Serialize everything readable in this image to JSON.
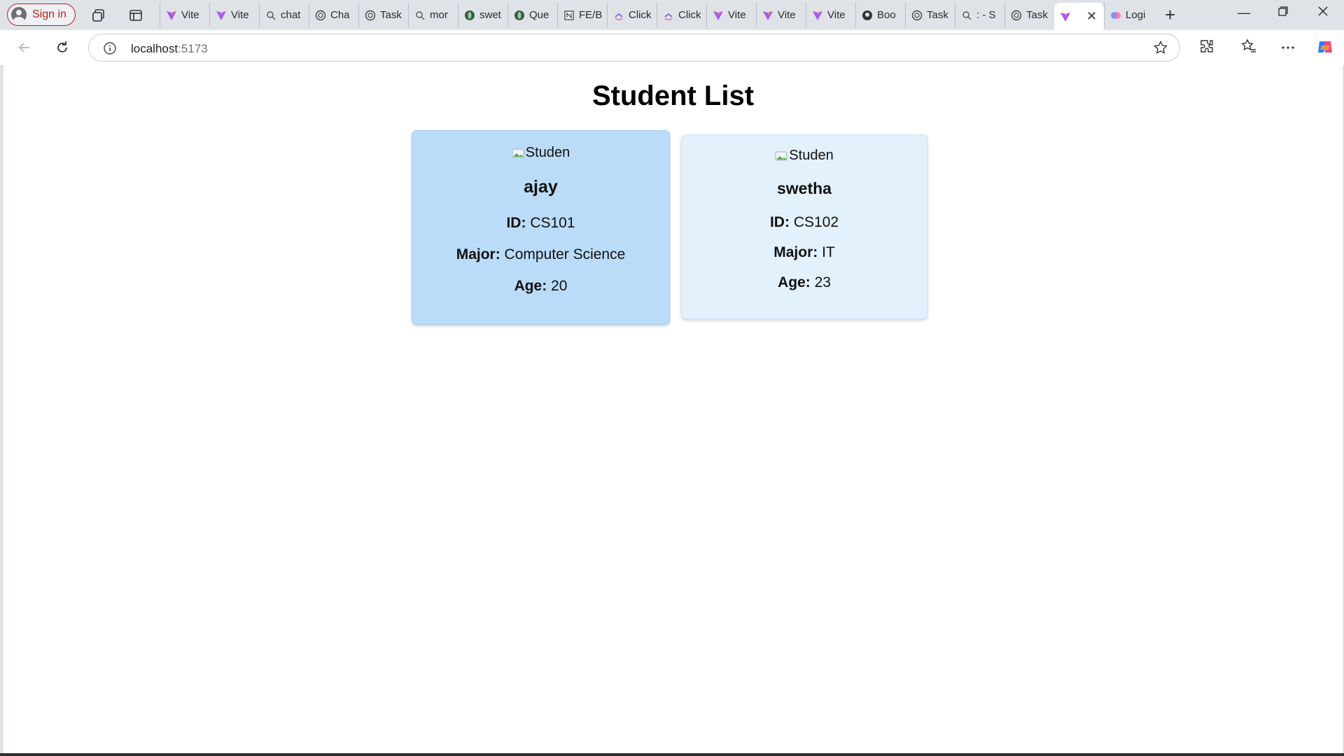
{
  "browser": {
    "signin_label": "Sign in",
    "tabs": [
      {
        "label": "Vite",
        "icon": "vite-icon"
      },
      {
        "label": "Vite",
        "icon": "vite-icon"
      },
      {
        "label": "chat",
        "icon": "search-icon"
      },
      {
        "label": "Cha",
        "icon": "chatgpt-icon"
      },
      {
        "label": "Task",
        "icon": "chatgpt-icon"
      },
      {
        "label": "mor",
        "icon": "search-icon"
      },
      {
        "label": "swet",
        "icon": "green-leaf-icon"
      },
      {
        "label": "Que",
        "icon": "green-leaf-icon"
      },
      {
        "label": "FE/B",
        "icon": "notion-icon"
      },
      {
        "label": "Click",
        "icon": "clickup-icon"
      },
      {
        "label": "Click",
        "icon": "clickup-icon"
      },
      {
        "label": "Vite",
        "icon": "vite-icon"
      },
      {
        "label": "Vite",
        "icon": "vite-icon"
      },
      {
        "label": "Vite",
        "icon": "vite-icon"
      },
      {
        "label": "Boo",
        "icon": "github-icon"
      },
      {
        "label": "Task",
        "icon": "chatgpt-icon"
      },
      {
        "label": ": - S",
        "icon": "search-icon"
      },
      {
        "label": "Task",
        "icon": "chatgpt-icon"
      },
      {
        "label": "",
        "icon": "vite-icon",
        "active": true
      },
      {
        "label": "Logi",
        "icon": "copilot-icon"
      }
    ],
    "url_host": "localhost",
    "url_port": ":5173"
  },
  "page": {
    "title": "Student List",
    "students": [
      {
        "img_alt": "Studen",
        "name": "ajay",
        "id_label": "ID:",
        "id": "CS101",
        "major_label": "Major:",
        "major": "Computer Science",
        "age_label": "Age:",
        "age": "20"
      },
      {
        "img_alt": "Studen",
        "name": "swetha",
        "id_label": "ID:",
        "id": "CS102",
        "major_label": "Major:",
        "major": "IT",
        "age_label": "Age:",
        "age": "23"
      }
    ]
  },
  "colors": {
    "card_hover": "#bbdcf8",
    "card": "#e3f1fd",
    "signin_accent": "#b3261e"
  }
}
